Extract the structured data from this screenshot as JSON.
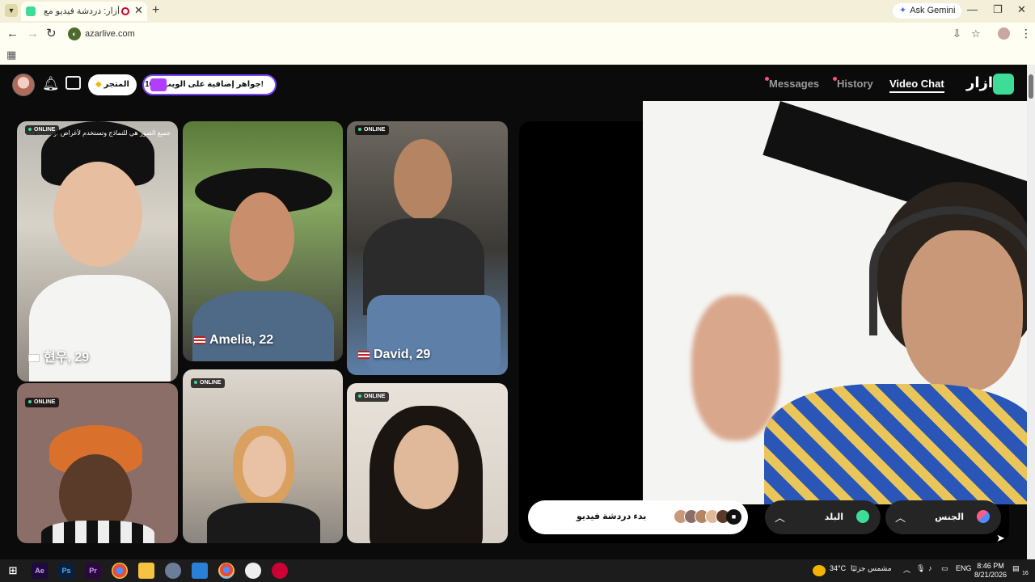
{
  "browser": {
    "tab_title": "أزار: دردشة فيديو مع أشخاص",
    "new_tab": "+",
    "close": "✕",
    "gemini_label": "Ask Gemini",
    "url": "azarlive.com",
    "window_controls": [
      "—",
      "❐",
      "✕"
    ]
  },
  "header": {
    "store_label": "المتجر",
    "promo_label": "10% جواهر إضافية على الويب!",
    "nav": [
      {
        "label": "Messages",
        "dot": true
      },
      {
        "label": "History",
        "dot": true
      },
      {
        "label": "Video Chat",
        "active": true
      }
    ],
    "brand": "ازار"
  },
  "profiles": [
    {
      "name": "현우, 29",
      "flag": "kr",
      "online": "ONLINE",
      "caption": "جميع الصور هي للنماذج وتستخدم لأغراض توضيحية فقط"
    },
    {
      "name": "Amelia, 22",
      "flag": "us",
      "online": ""
    },
    {
      "name": "David, 29",
      "flag": "us",
      "online": "ONLINE"
    },
    {
      "name": "",
      "online": "ONLINE"
    },
    {
      "name": "",
      "online": "ONLINE"
    },
    {
      "name": "",
      "online": "ONLINE"
    }
  ],
  "controls": {
    "start_label": "بدء دردشة فيديو",
    "country_label": "البلد",
    "gender_label": "الجنس"
  },
  "taskbar": {
    "apps": [
      "Ae",
      "Ps",
      "Pr"
    ],
    "weather_temp": "34°C",
    "weather_text": "مشمس جزئيًا",
    "lang": "ENG",
    "time": "8:46 PM",
    "date": "8/21/2026",
    "notif_count": "16"
  },
  "colors": {
    "accent": "#3ddc97",
    "promo_border": "#7b45ff",
    "nav_dot": "#ff4d7d"
  }
}
